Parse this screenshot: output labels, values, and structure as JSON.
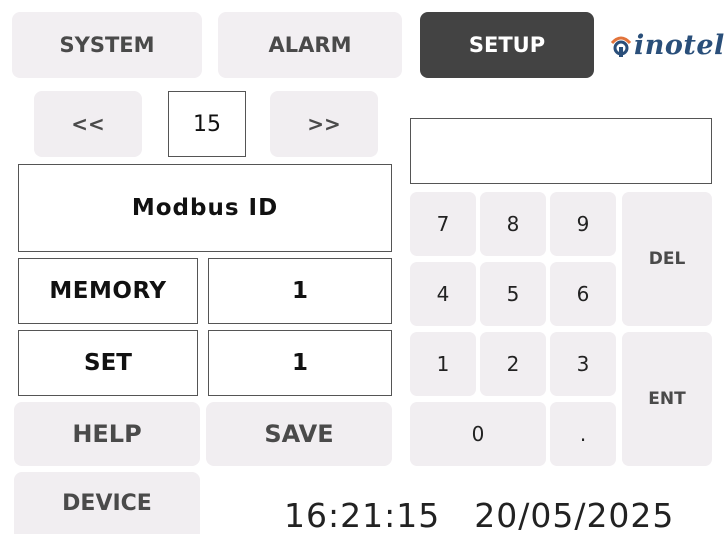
{
  "tabs": [
    {
      "label": "SYSTEM"
    },
    {
      "label": "ALARM"
    },
    {
      "label": "SETUP",
      "active": true
    }
  ],
  "logo": {
    "text": "inotel"
  },
  "pager": {
    "prev_label": "<<",
    "page": "15",
    "next_label": ">>"
  },
  "param": {
    "title": "Modbus ID"
  },
  "rows": {
    "memory": {
      "label": "MEMORY",
      "value": "1"
    },
    "set": {
      "label": "SET",
      "value": "1"
    }
  },
  "actions": {
    "help": "HELP",
    "save": "SAVE",
    "device": "DEVICE"
  },
  "keypad": {
    "display": "",
    "keys": [
      "7",
      "8",
      "9",
      "4",
      "5",
      "6",
      "1",
      "2",
      "3",
      "0",
      "."
    ],
    "del": "DEL",
    "ent": "ENT"
  },
  "status": {
    "time": "16:21:15",
    "date": "20/05/2025"
  },
  "colors": {
    "active_tab": "#434343",
    "button_bg": "#f1eef1",
    "logo": "#2a4f7a",
    "logo_accent": "#e2733a"
  }
}
